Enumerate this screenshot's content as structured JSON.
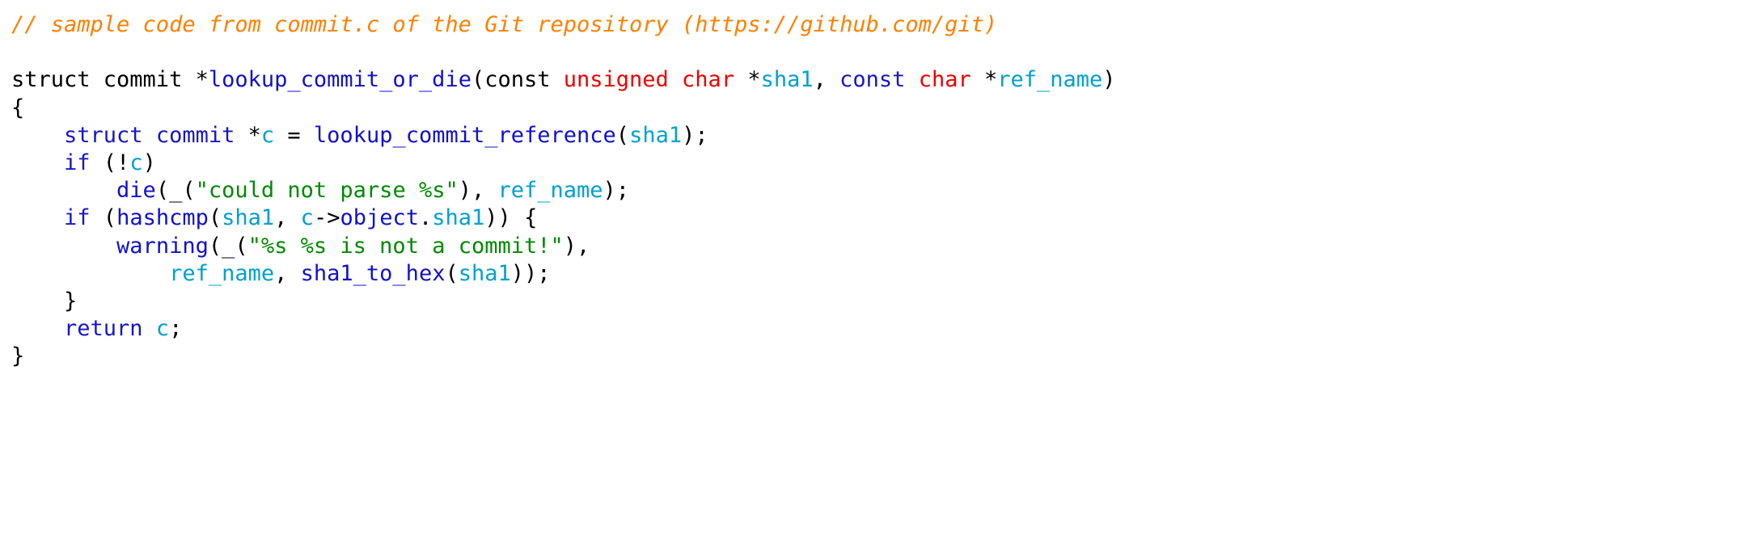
{
  "editor": {
    "language": "C",
    "background": "#ffffff",
    "palette": {
      "plain": "#000000",
      "comment": "#FF8000",
      "keyword": "#1717C4",
      "type": "#EE0000",
      "function": "#1111CC",
      "variable": "#00A0D0",
      "string": "#008A00"
    },
    "full_text": "// sample code from commit.c of the Git repository (https://github.com/git)\n\nstruct commit *lookup_commit_or_die(const unsigned char *sha1, const char *ref_name)\n{\n    struct commit *c = lookup_commit_reference(sha1);\n    if (!c)\n        die(_(\"could not parse %s\"), ref_name);\n    if (hashcmp(sha1, c->object.sha1)) {\n        warning(_(\"%s %s is not a commit!\"),\n            ref_name, sha1_to_hex(sha1));\n    }\n    return c;\n}",
    "lines": [
      {
        "id": "line-1-comment",
        "tokens": [
          {
            "text": "// sample code from commit.c of the Git repository (https://github.com/git)",
            "cls": "t-comment"
          }
        ]
      },
      {
        "id": "line-2-blank",
        "tokens": [
          {
            "text": " ",
            "cls": "t-plain"
          }
        ]
      },
      {
        "id": "line-3-signature",
        "tokens": [
          {
            "text": "struct commit *",
            "cls": "t-plain"
          },
          {
            "text": "lookup_commit_or_die",
            "cls": "t-func"
          },
          {
            "text": "(const ",
            "cls": "t-plain"
          },
          {
            "text": "unsigned char",
            "cls": "t-type"
          },
          {
            "text": " *",
            "cls": "t-plain"
          },
          {
            "text": "sha1",
            "cls": "t-var"
          },
          {
            "text": ", ",
            "cls": "t-plain"
          },
          {
            "text": "const",
            "cls": "t-keyword"
          },
          {
            "text": " ",
            "cls": "t-plain"
          },
          {
            "text": "char",
            "cls": "t-type"
          },
          {
            "text": " *",
            "cls": "t-plain"
          },
          {
            "text": "ref_name",
            "cls": "t-var"
          },
          {
            "text": ")",
            "cls": "t-plain"
          }
        ]
      },
      {
        "id": "line-4-open-brace",
        "tokens": [
          {
            "text": "{",
            "cls": "t-plain"
          }
        ]
      },
      {
        "id": "line-5-declaration",
        "tokens": [
          {
            "text": "    ",
            "cls": "t-plain"
          },
          {
            "text": "struct commit",
            "cls": "t-keyword"
          },
          {
            "text": " *",
            "cls": "t-plain"
          },
          {
            "text": "c",
            "cls": "t-var"
          },
          {
            "text": " = ",
            "cls": "t-plain"
          },
          {
            "text": "lookup_commit_reference",
            "cls": "t-func"
          },
          {
            "text": "(",
            "cls": "t-plain"
          },
          {
            "text": "sha1",
            "cls": "t-var"
          },
          {
            "text": ");",
            "cls": "t-plain"
          }
        ]
      },
      {
        "id": "line-6-if-not-c",
        "tokens": [
          {
            "text": "    ",
            "cls": "t-plain"
          },
          {
            "text": "if",
            "cls": "t-keyword"
          },
          {
            "text": " (!",
            "cls": "t-plain"
          },
          {
            "text": "c",
            "cls": "t-var"
          },
          {
            "text": ")",
            "cls": "t-plain"
          }
        ]
      },
      {
        "id": "line-7-die-call",
        "tokens": [
          {
            "text": "        ",
            "cls": "t-plain"
          },
          {
            "text": "die",
            "cls": "t-func"
          },
          {
            "text": "(_(",
            "cls": "t-plain"
          },
          {
            "text": "\"could not parse %s\"",
            "cls": "t-string"
          },
          {
            "text": "), ",
            "cls": "t-plain"
          },
          {
            "text": "ref_name",
            "cls": "t-var"
          },
          {
            "text": ");",
            "cls": "t-plain"
          }
        ]
      },
      {
        "id": "line-8-if-hashcmp",
        "tokens": [
          {
            "text": "    ",
            "cls": "t-plain"
          },
          {
            "text": "if",
            "cls": "t-keyword"
          },
          {
            "text": " (",
            "cls": "t-plain"
          },
          {
            "text": "hashcmp",
            "cls": "t-func"
          },
          {
            "text": "(",
            "cls": "t-plain"
          },
          {
            "text": "sha1",
            "cls": "t-var"
          },
          {
            "text": ", ",
            "cls": "t-plain"
          },
          {
            "text": "c",
            "cls": "t-var"
          },
          {
            "text": "->",
            "cls": "t-plain"
          },
          {
            "text": "object",
            "cls": "t-func"
          },
          {
            "text": ".",
            "cls": "t-plain"
          },
          {
            "text": "sha1",
            "cls": "t-var"
          },
          {
            "text": ")) {",
            "cls": "t-plain"
          }
        ]
      },
      {
        "id": "line-9-warning-call",
        "tokens": [
          {
            "text": "        ",
            "cls": "t-plain"
          },
          {
            "text": "warning",
            "cls": "t-func"
          },
          {
            "text": "(_(",
            "cls": "t-plain"
          },
          {
            "text": "\"%s %s is not a commit!\"",
            "cls": "t-string"
          },
          {
            "text": "),",
            "cls": "t-plain"
          }
        ]
      },
      {
        "id": "line-10-warning-args",
        "tokens": [
          {
            "text": "            ",
            "cls": "t-plain"
          },
          {
            "text": "ref_name",
            "cls": "t-var"
          },
          {
            "text": ", ",
            "cls": "t-plain"
          },
          {
            "text": "sha1_to_hex",
            "cls": "t-func"
          },
          {
            "text": "(",
            "cls": "t-plain"
          },
          {
            "text": "sha1",
            "cls": "t-var"
          },
          {
            "text": "));",
            "cls": "t-plain"
          }
        ]
      },
      {
        "id": "line-11-close-if-brace",
        "tokens": [
          {
            "text": "    }",
            "cls": "t-plain"
          }
        ]
      },
      {
        "id": "line-12-return",
        "tokens": [
          {
            "text": "    ",
            "cls": "t-plain"
          },
          {
            "text": "return",
            "cls": "t-keyword"
          },
          {
            "text": " ",
            "cls": "t-plain"
          },
          {
            "text": "c",
            "cls": "t-var"
          },
          {
            "text": ";",
            "cls": "t-plain"
          }
        ]
      },
      {
        "id": "line-13-close-brace",
        "tokens": [
          {
            "text": "}",
            "cls": "t-plain"
          }
        ]
      }
    ]
  }
}
